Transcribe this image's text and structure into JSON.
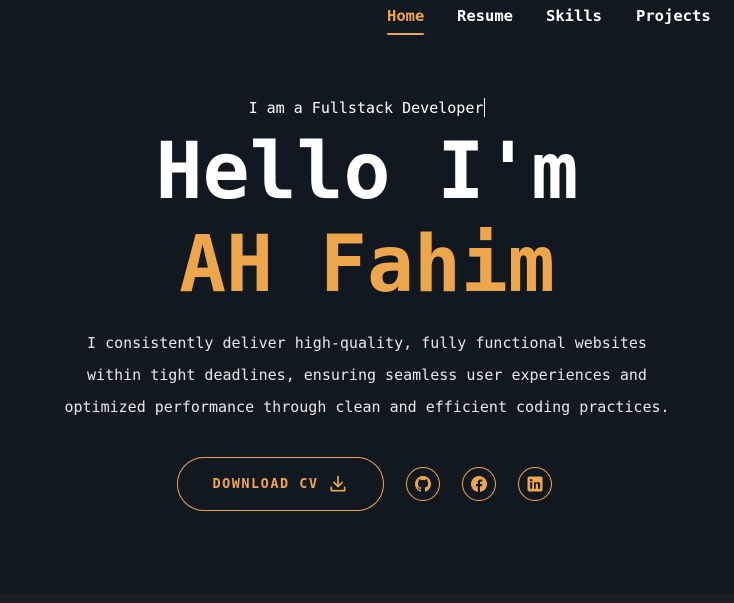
{
  "nav": {
    "items": [
      {
        "label": "Home",
        "active": true
      },
      {
        "label": "Resume",
        "active": false
      },
      {
        "label": "Skills",
        "active": false
      },
      {
        "label": "Projects",
        "active": false
      }
    ]
  },
  "hero": {
    "role": "I am a Fullstack Developer",
    "greeting": "Hello I'm",
    "name": "AH Fahim",
    "description_lines": [
      "I consistently deliver high-quality, fully functional websites",
      "within tight deadlines, ensuring seamless user experiences and",
      "optimized performance through clean and efficient coding practices."
    ],
    "cv_button": {
      "label": "DOWNLOAD CV",
      "icon": "download-icon"
    }
  },
  "social": [
    {
      "icon": "github-icon"
    },
    {
      "icon": "facebook-icon"
    },
    {
      "icon": "linkedin-icon"
    }
  ],
  "colors": {
    "background": "#121820",
    "accent": "#eea64a",
    "text": "#ffffff"
  }
}
